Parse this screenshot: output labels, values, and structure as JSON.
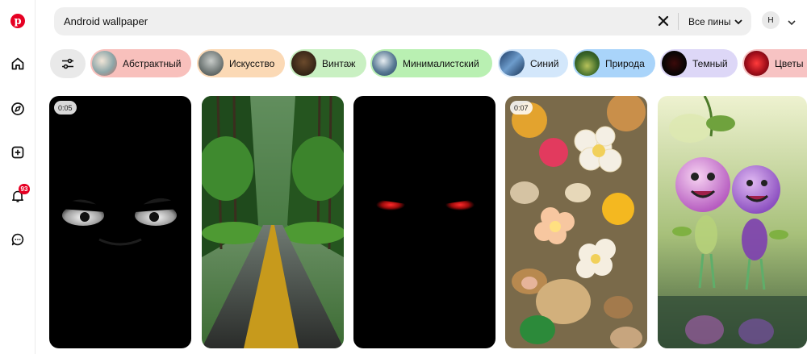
{
  "search": {
    "value": "Android wallpaper",
    "scope_label": "Все пины"
  },
  "sidebar": {
    "notifications_count": "93",
    "icons": [
      "pinterest-logo",
      "home-icon",
      "explore-icon",
      "create-icon",
      "bell-icon",
      "messages-icon"
    ]
  },
  "account": {
    "initial": "Н"
  },
  "chips": [
    {
      "label": "Абстрактный",
      "bg": "#f8c0bc"
    },
    {
      "label": "Искусство",
      "bg": "#fbd9b5"
    },
    {
      "label": "Винтаж",
      "bg": "#c9f0c2"
    },
    {
      "label": "Минималистский",
      "bg": "#b9f0b2"
    },
    {
      "label": "Синий",
      "bg": "#d3e7fb"
    },
    {
      "label": "Природа",
      "bg": "#a9d4fa"
    },
    {
      "label": "Темный",
      "bg": "#ddd7f7"
    },
    {
      "label": "Цветы",
      "bg": "#f7c3c3"
    }
  ],
  "pins": [
    {
      "video_length": "0:05",
      "subject": "angry eyes in darkness"
    },
    {
      "subject": "forest road with yellow line"
    },
    {
      "subject": "red eyes in darkness"
    },
    {
      "video_length": "0:07",
      "subject": "flowers, pebbles and koi fish"
    },
    {
      "subject": "glass smiley characters"
    }
  ],
  "colors": {
    "brand": "#e60023",
    "search_bg": "#efefef",
    "filter_bg": "#e9e9e9"
  }
}
